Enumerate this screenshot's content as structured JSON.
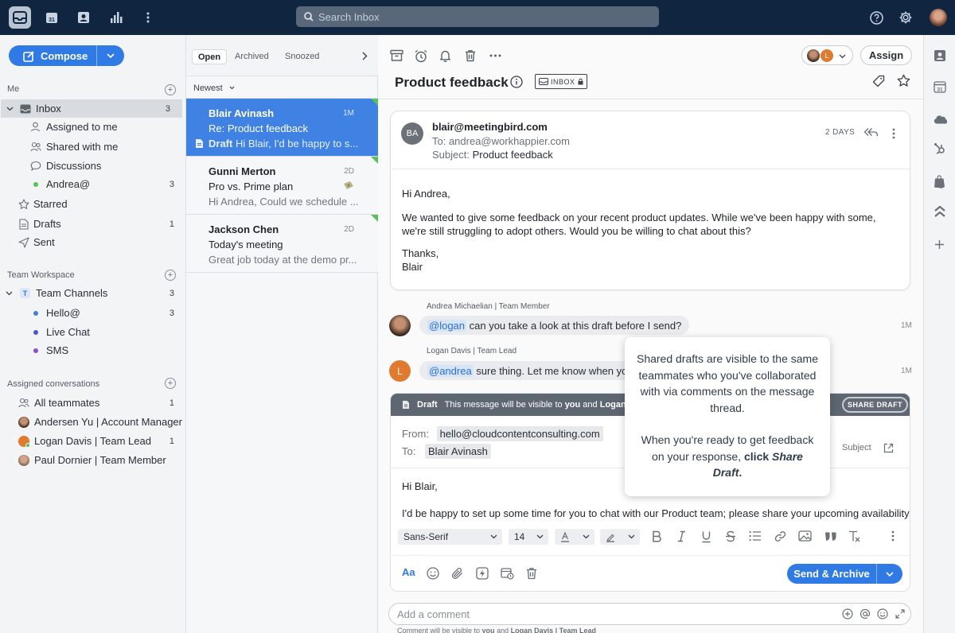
{
  "search": {
    "placeholder": "Search Inbox"
  },
  "sidebar": {
    "compose_label": "Compose",
    "sections": {
      "me": "Me",
      "team": "Team Workspace",
      "assigned": "Assigned conversations"
    },
    "me_items": [
      {
        "label": "Inbox",
        "count": "3"
      },
      {
        "label": "Assigned to me",
        "count": ""
      },
      {
        "label": "Shared with me",
        "count": ""
      },
      {
        "label": "Discussions",
        "count": ""
      },
      {
        "label": "Andrea@",
        "count": "3"
      },
      {
        "label": "Starred",
        "count": ""
      },
      {
        "label": "Drafts",
        "count": "1"
      },
      {
        "label": "Sent",
        "count": ""
      }
    ],
    "team_items": [
      {
        "label": "Team Channels",
        "count": "3"
      },
      {
        "label": "Hello@",
        "count": "3"
      },
      {
        "label": "Live Chat",
        "count": ""
      },
      {
        "label": "SMS",
        "count": ""
      }
    ],
    "team_badge": "T",
    "assigned_items": [
      {
        "label": "All teammates",
        "count": "1"
      },
      {
        "label": "Andersen Yu | Account Manager",
        "count": ""
      },
      {
        "label": "Logan Davis | Team Lead",
        "count": "1"
      },
      {
        "label": "Paul Dornier | Team Member",
        "count": ""
      }
    ]
  },
  "list": {
    "tabs": [
      "Open",
      "Archived",
      "Snoozed"
    ],
    "sort": "Newest",
    "items": [
      {
        "name": "Blair Avinash",
        "age": "1M",
        "subject": "Re: Product feedback",
        "draft": "Draft",
        "preview": "Hi Blair, I'd be happy to s..."
      },
      {
        "name": "Gunni Merton",
        "age": "2D",
        "subject": "Pro vs. Prime plan",
        "preview": "Hi Andrea, Could we schedule ..."
      },
      {
        "name": "Jackson Chen",
        "age": "2D",
        "subject": "Today's meeting",
        "preview": "Great job today at the demo pr..."
      }
    ]
  },
  "thread": {
    "title": "Product feedback",
    "tag": "INBOX",
    "assign_label": "Assign",
    "assignee_initial": "L",
    "message": {
      "initials": "BA",
      "from": "blair@meetingbird.com",
      "to": "To: andrea@workhappier.com",
      "subject_label": "Subject:",
      "subject": "Product feedback",
      "age": "2 DAYS",
      "body": [
        "Hi Andrea,",
        "We wanted to give some feedback on your recent product updates. While we've been happy with some, we're still struggling to adopt others. Would you be willing to chat about this?",
        "Thanks,",
        "Blair"
      ]
    },
    "comments": [
      {
        "author": "Andrea Michaelian | Team Member",
        "mention": "@logan",
        "text": " can you take a look at this draft before I send?",
        "time": "1M"
      },
      {
        "author": "Logan Davis | Team Lead",
        "mention": "@andrea",
        "text": " sure thing. Let me know when you",
        "time": "1M",
        "avatar": "L"
      }
    ],
    "draft": {
      "label": "Draft",
      "note_pre": "This message will be visible to ",
      "note_you": "you",
      "note_and": " and ",
      "note_logan": "Logan",
      "share_label": "SHARE DRAFT",
      "from_label": "From:",
      "from": "hello@cloudcontentconsulting.com",
      "to_label": "To:",
      "to": "Blair Avinash",
      "subject_link": "Subject",
      "greeting": "Hi Blair,",
      "body": "I'd be happy to set up some time for you to chat with our Product team; please share your upcoming availability",
      "font": "Sans-Serif",
      "size": "14",
      "send_label": "Send & Archive"
    },
    "comment_placeholder": "Add a comment",
    "comment_note": {
      "pre": "Comment will be visible to ",
      "you": "you",
      "and": " and ",
      "who": "Logan Davis | Team Lead"
    }
  },
  "tooltip": {
    "p1": "Shared drafts are visible to the same teammates who you've collaborated with via comments on the message thread.",
    "p2_pre": "When you're ready to get feedback on your response, ",
    "p2_bold": "click ",
    "p2_em": "Share Draft",
    "p2_end": "."
  },
  "colors": {
    "accent": "#2f7ae5",
    "topbar": "#0f2540",
    "selected_row": "#3f82e3",
    "online": "#57c25a"
  }
}
